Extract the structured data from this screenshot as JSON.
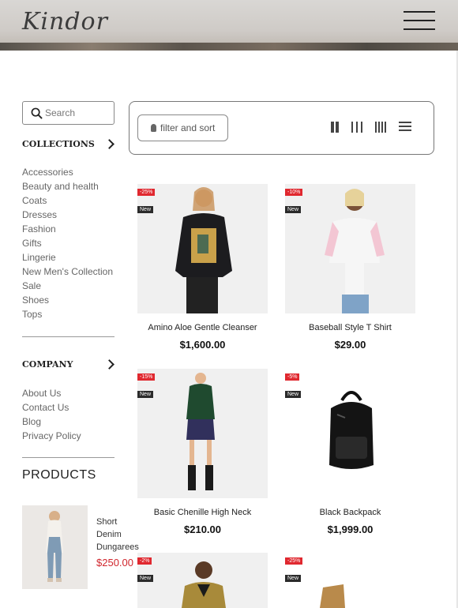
{
  "header": {
    "logo": "Kindor",
    "menu_icon": "hamburger-icon"
  },
  "sidebar": {
    "search_placeholder": "Search",
    "collections": {
      "title": "COLLECTIONS",
      "items": [
        "Accessories",
        "Beauty and health",
        "Coats",
        "Dresses",
        "Fashion",
        "Gifts",
        "Lingerie",
        "New Men's Collection",
        "Sale",
        "Shoes",
        "Tops"
      ]
    },
    "company": {
      "title": "COMPANY",
      "items": [
        "About Us",
        "Contact Us",
        "Blog",
        "Privacy Policy"
      ]
    },
    "products_title": "PRODUCTS",
    "featured": {
      "name": "Short Denim Dungarees",
      "price": "$250.00"
    }
  },
  "toolbar": {
    "filter_label": "filter and sort",
    "views": [
      "grid-2-icon",
      "grid-3-icon",
      "grid-4-icon",
      "list-icon"
    ]
  },
  "products": [
    {
      "name": "Amino Aloe Gentle Cleanser",
      "price": "$1,600.00",
      "discount": "-25%",
      "badge": "New"
    },
    {
      "name": "Baseball Style T Shirt",
      "price": "$29.00",
      "discount": "-10%",
      "badge": "New"
    },
    {
      "name": "Basic Chenille High Neck",
      "price": "$210.00",
      "discount": "-15%",
      "badge": "New"
    },
    {
      "name": "Black Backpack",
      "price": "$1,999.00",
      "discount": "-5%",
      "badge": "New"
    },
    {
      "name": "",
      "price": "",
      "discount": "-2%",
      "badge": "New"
    },
    {
      "name": "",
      "price": "",
      "discount": "-25%",
      "badge": "New"
    }
  ],
  "colors": {
    "sale_red": "#e0282f",
    "price_red": "#d0262d"
  }
}
